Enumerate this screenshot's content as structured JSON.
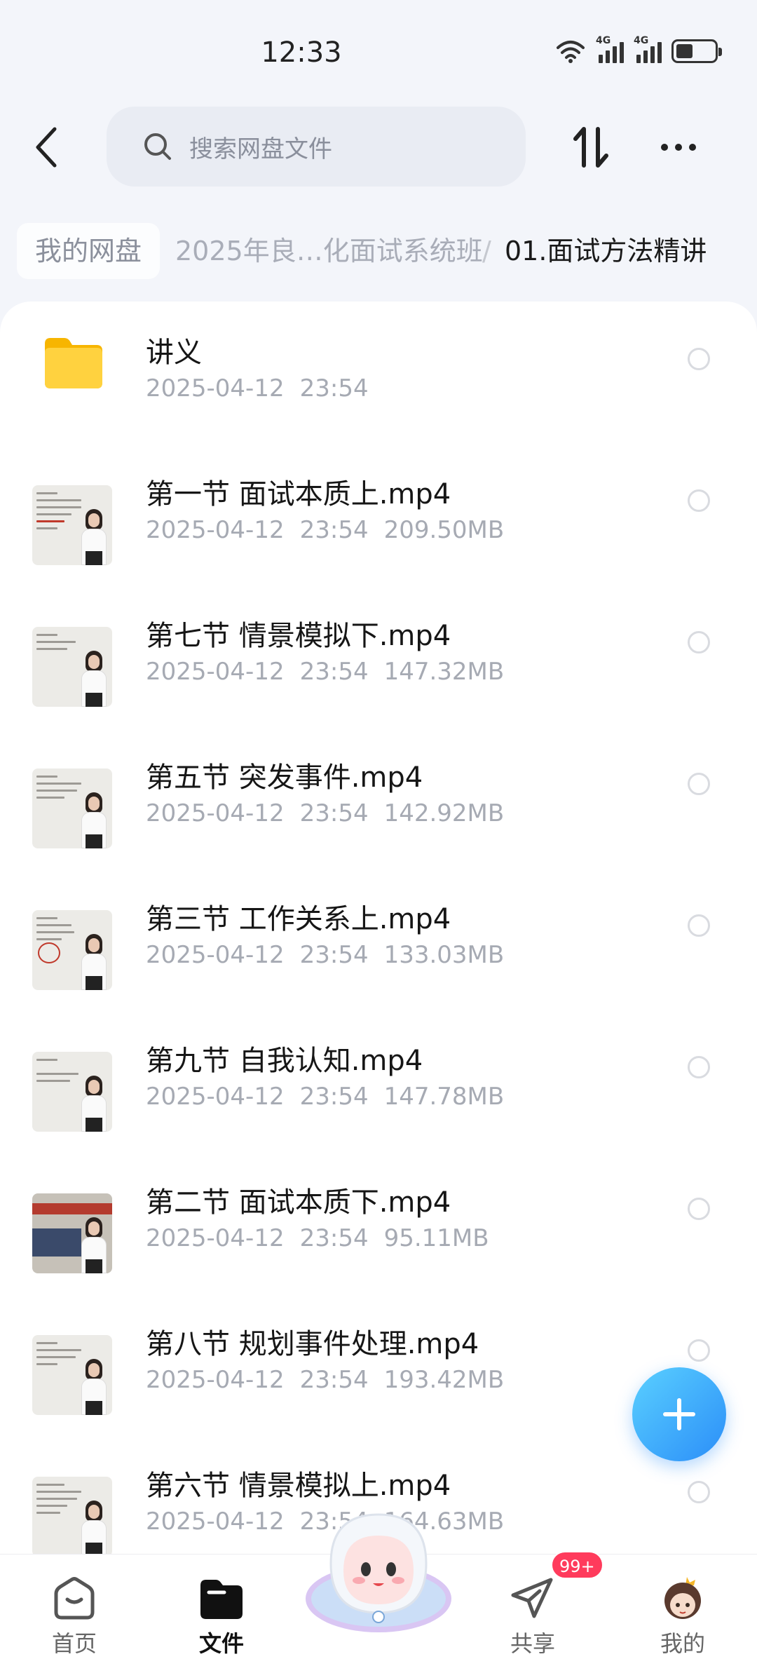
{
  "status_bar": {
    "time": "12:33",
    "signal_1_label": "4G",
    "signal_2_label": "4G",
    "battery_percent": 45,
    "icons": [
      "wifi-icon",
      "signal-icon",
      "signal-icon",
      "battery-icon"
    ]
  },
  "top_bar": {
    "search_placeholder": "搜索网盘文件",
    "icons": [
      "back-arrow-icon",
      "search-icon",
      "sort-icon",
      "more-icon"
    ]
  },
  "breadcrumb": {
    "root": "我的网盘",
    "middle": "2025年良…化面试系统班",
    "separator": "/",
    "current": "01.面试方法精讲"
  },
  "files": [
    {
      "name": "讲义",
      "date": "2025-04-12",
      "time": "23:54",
      "size": "",
      "type": "folder"
    },
    {
      "name": "第一节 面试本质上.mp4",
      "date": "2025-04-12",
      "time": "23:54",
      "size": "209.50MB",
      "type": "video"
    },
    {
      "name": "第七节 情景模拟下.mp4",
      "date": "2025-04-12",
      "time": "23:54",
      "size": "147.32MB",
      "type": "video"
    },
    {
      "name": "第五节 突发事件.mp4",
      "date": "2025-04-12",
      "time": "23:54",
      "size": "142.92MB",
      "type": "video"
    },
    {
      "name": "第三节 工作关系上.mp4",
      "date": "2025-04-12",
      "time": "23:54",
      "size": "133.03MB",
      "type": "video"
    },
    {
      "name": "第九节 自我认知.mp4",
      "date": "2025-04-12",
      "time": "23:54",
      "size": "147.78MB",
      "type": "video"
    },
    {
      "name": "第二节 面试本质下.mp4",
      "date": "2025-04-12",
      "time": "23:54",
      "size": "95.11MB",
      "type": "video"
    },
    {
      "name": "第八节 规划事件处理.mp4",
      "date": "2025-04-12",
      "time": "23:54",
      "size": "193.42MB",
      "type": "video"
    },
    {
      "name": "第六节 情景模拟上.mp4",
      "date": "2025-04-12",
      "time": "23:54",
      "size": "164.63MB",
      "type": "video"
    }
  ],
  "fab": {
    "icon": "plus-icon"
  },
  "bottom_nav": {
    "items": [
      {
        "label": "首页",
        "icon": "home-icon",
        "active": false
      },
      {
        "label": "文件",
        "icon": "folder-icon",
        "active": true
      },
      {
        "label": "",
        "icon": "mascot-icon",
        "active": false
      },
      {
        "label": "共享",
        "icon": "share-plane-icon",
        "active": false
      },
      {
        "label": "我的",
        "icon": "avatar-icon",
        "active": false
      }
    ],
    "share_badge": "99+"
  },
  "colors": {
    "background": "#f3f5fa",
    "accent": "#2b8ef8",
    "folder": "#ffcc33",
    "badge": "#ff3b5c",
    "meta_text": "#a6aab3"
  }
}
